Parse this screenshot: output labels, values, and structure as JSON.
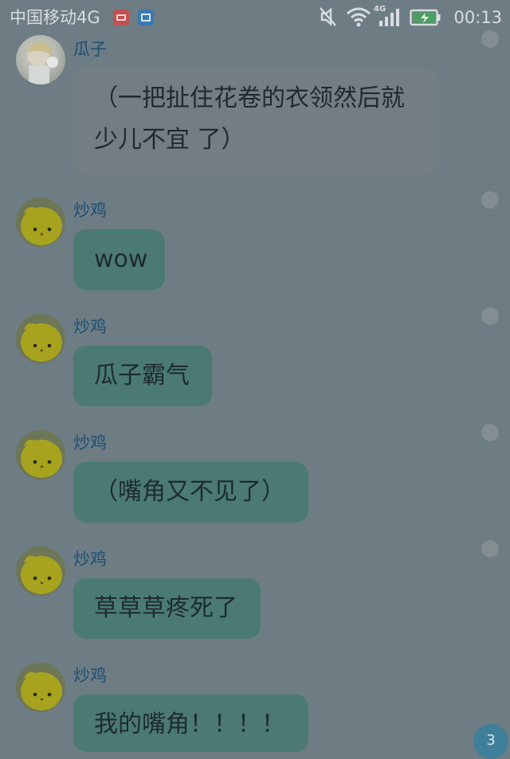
{
  "status_bar": {
    "carrier": "中国移动4G",
    "network_type": "4G",
    "time": "00:13",
    "icons": [
      "mail-notification-icon",
      "gallery-notification-icon",
      "mute-icon",
      "wifi-icon",
      "signal-icon",
      "battery-charging-icon"
    ]
  },
  "messages": [
    {
      "sender": "瓜子",
      "avatar": "guazi-avatar",
      "lines": [
        "（一把扯住花卷的衣领然后就",
        "少儿不宜 了）"
      ],
      "style": "gray"
    },
    {
      "sender": "炒鸡",
      "avatar": "chick-avatar",
      "lines": [
        "wow"
      ],
      "style": "teal"
    },
    {
      "sender": "炒鸡",
      "avatar": "chick-avatar",
      "lines": [
        "瓜子霸气"
      ],
      "style": "teal"
    },
    {
      "sender": "炒鸡",
      "avatar": "chick-avatar",
      "lines": [
        "（嘴角又不见了）"
      ],
      "style": "teal"
    },
    {
      "sender": "炒鸡",
      "avatar": "chick-avatar",
      "lines": [
        "草草草疼死了"
      ],
      "style": "teal"
    },
    {
      "sender": "炒鸡",
      "avatar": "chick-avatar",
      "lines": [
        "我的嘴角！！！！"
      ],
      "style": "teal"
    }
  ],
  "unread_badge": "3",
  "colors": {
    "background": "#6e7c84",
    "sender_name": "#1d4f73",
    "bubble_gray": "#737e83",
    "bubble_teal": "#4b7a73",
    "badge": "#3f7f99"
  }
}
